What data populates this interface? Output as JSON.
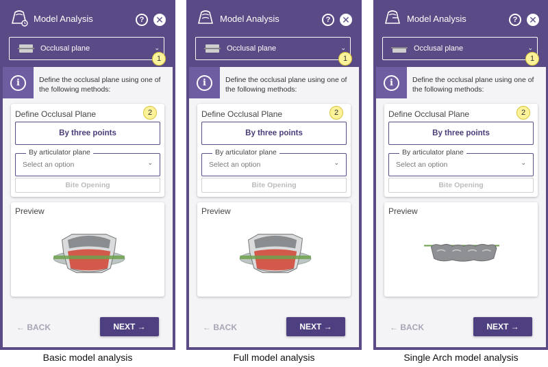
{
  "panels": [
    {
      "title": "Model Analysis",
      "help_glyph": "?",
      "close_glyph": "✕",
      "plane_select": "Occlusal plane",
      "badge1": "1",
      "info_text": "Define the occlusal plane using one of the following methods:",
      "info_glyph": "i",
      "define_title": "Define Occlusal Plane",
      "badge2": "2",
      "three_points": "By three points",
      "articulator_legend": "By articulator plane",
      "articulator_placeholder": "Select an option",
      "bite_opening": "Bite Opening",
      "preview_title": "Preview",
      "back": "← BACK",
      "next": "NEXT →",
      "caption": "Basic model analysis"
    },
    {
      "title": "Model Analysis",
      "help_glyph": "?",
      "close_glyph": "✕",
      "plane_select": "Occlusal plane",
      "badge1": "1",
      "info_text": "Define the occlusal plane using one of the following methods:",
      "info_glyph": "i",
      "define_title": "Define Occlusal Plane",
      "badge2": "2",
      "three_points": "By three points",
      "articulator_legend": "By articulator plane",
      "articulator_placeholder": "Select an option",
      "bite_opening": "Bite Opening",
      "preview_title": "Preview",
      "back": "← BACK",
      "next": "NEXT →",
      "caption": "Full model analysis"
    },
    {
      "title": "Model Analysis",
      "help_glyph": "?",
      "close_glyph": "✕",
      "plane_select": "Occlusal plane",
      "badge1": "1",
      "info_text": "Define the occlusal plane using one of the following methods:",
      "info_glyph": "i",
      "define_title": "Define Occlusal Plane",
      "badge2": "2",
      "three_points": "By three points",
      "articulator_legend": "By articulator plane",
      "articulator_placeholder": "Select an option",
      "bite_opening": "Bite Opening",
      "preview_title": "Preview",
      "back": "← BACK",
      "next": "NEXT →",
      "caption": "Single Arch model analysis"
    }
  ],
  "icons": {
    "logo": "tooth-model-icon",
    "help": "help-icon",
    "close": "close-icon",
    "plane": "occlusal-plane-icon",
    "info": "info-icon",
    "chevron": "chevron-down-icon",
    "back": "arrow-left-icon",
    "next": "arrow-right-icon"
  },
  "colors": {
    "panel": "#5a4a86",
    "accent": "#4e3f80",
    "badge": "#fbf29a",
    "info_bg": "#6f5da1"
  }
}
